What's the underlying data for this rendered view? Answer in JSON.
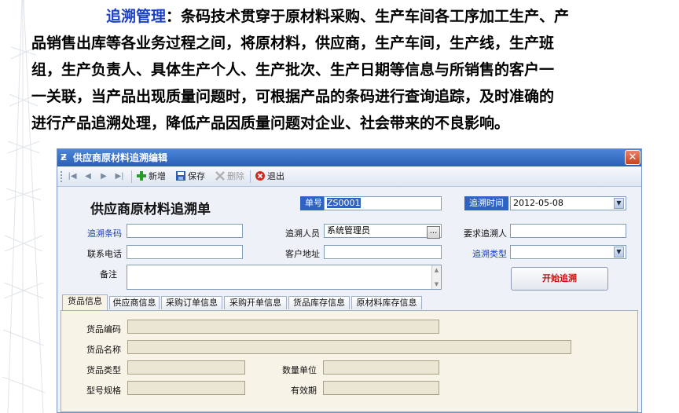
{
  "article": {
    "lead": "追溯管理",
    "line1_rest": "：条码技术贯穿于原材料采购、生产车间各工序加工生产、产",
    "line2": "品销售出库等各业务过程之间，将原材料，供应商，生产车间，生产线，生产班",
    "line3": "组，生产负责人、具体生产个人、生产批次、生产日期等信息与所销售的客户一",
    "line4": "一关联，当产品出现质量问题时，可根据产品的条码进行查询追踪，及时准确的",
    "line5": "进行产品追溯处理，降低产品因质量问题对企业、社会带来的不良影响。"
  },
  "window": {
    "title": "供应商原材料追溯编辑",
    "close_label": "✕"
  },
  "toolbar": {
    "nav_first": "|◀",
    "nav_prev": "◀",
    "nav_next": "▶",
    "nav_last": "▶|",
    "new_label": "新增",
    "save_label": "保存",
    "delete_label": "删除",
    "exit_label": "退出"
  },
  "form": {
    "title": "供应商原材料追溯单",
    "order_no_label": "单号",
    "order_no_value": "ZS0001",
    "trace_time_label": "追溯时间",
    "trace_time_value": "2012-05-08",
    "trace_code_label": "追溯条码",
    "trace_code_value": "",
    "tracer_label": "追溯人员",
    "tracer_value": "系统管理员",
    "tracer_button": "...",
    "requester_label": "要求追溯人",
    "requester_value": "",
    "phone_label": "联系电话",
    "phone_value": "",
    "address_label": "客户地址",
    "address_value": "",
    "trace_type_label": "追溯类型",
    "trace_type_value": "",
    "remark_label": "备注",
    "remark_value": "",
    "start_button": "开始追溯"
  },
  "tabs": [
    "货品信息",
    "供应商信息",
    "采购订单信息",
    "采购开单信息",
    "货品库存信息",
    "原材料库存信息"
  ],
  "goods": {
    "code_label": "货品编码",
    "name_label": "货品名称",
    "type_label": "货品类型",
    "qty_unit_label": "数量单位",
    "model_label": "型号规格",
    "expiry_label": "有效期"
  },
  "colors": {
    "accent": "#2f63c2",
    "lead_text": "#1a3fc8",
    "start_button_text": "#c81010"
  }
}
